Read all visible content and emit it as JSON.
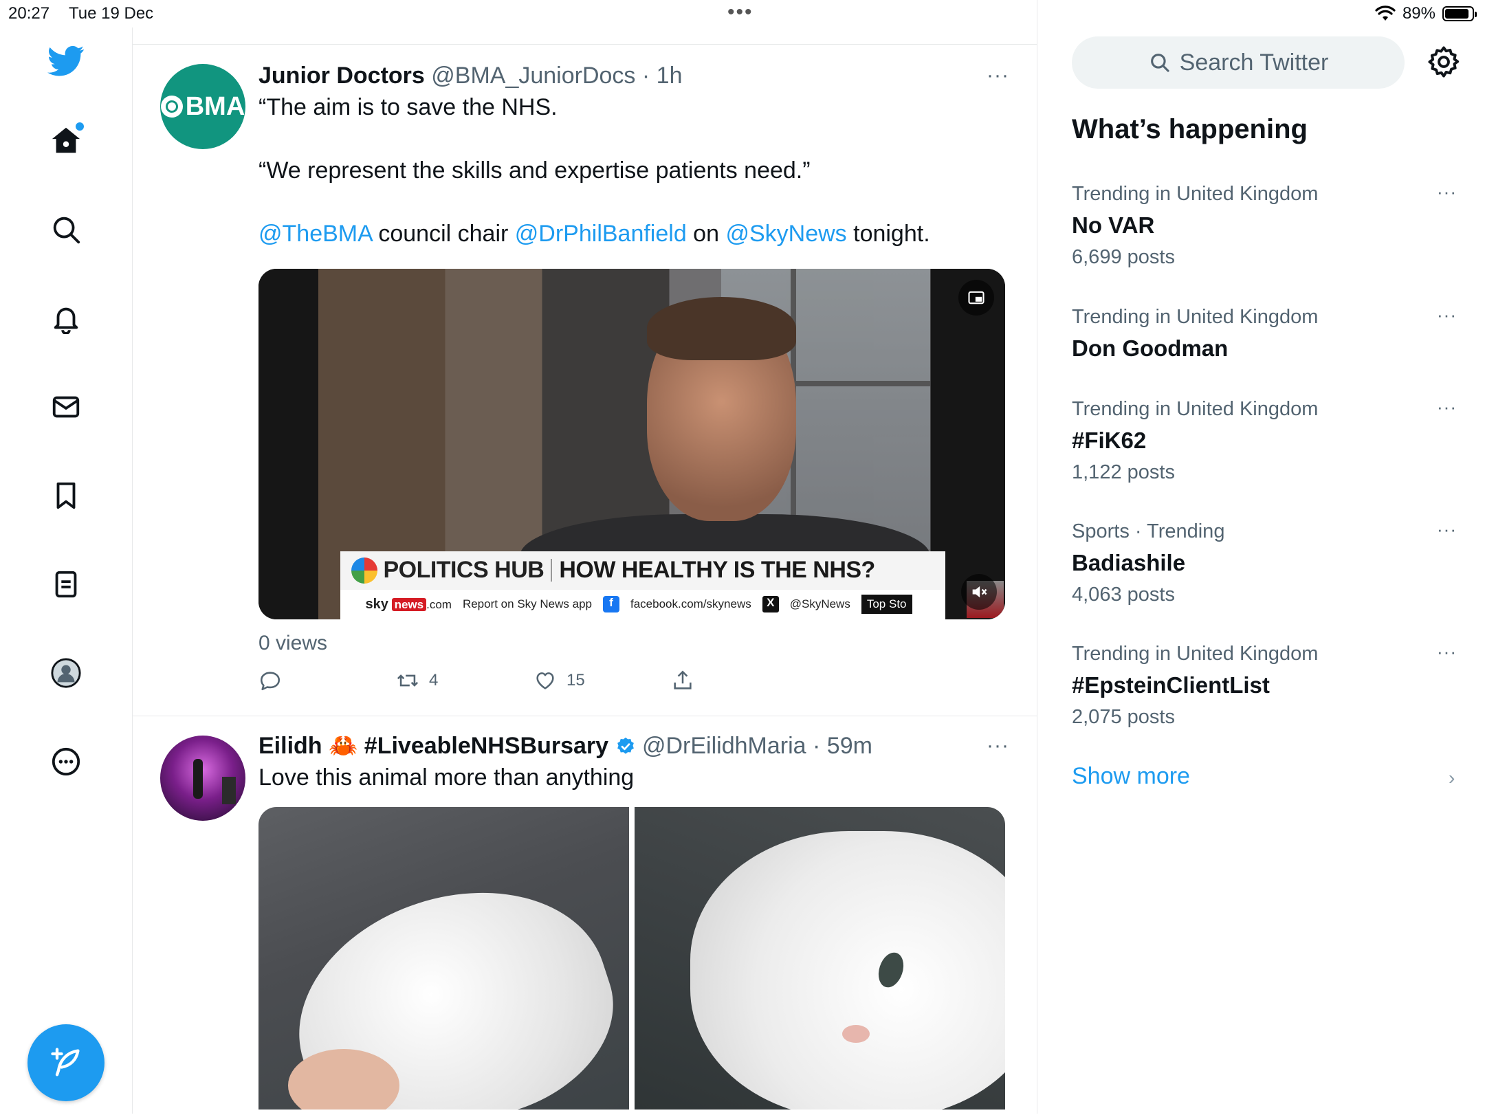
{
  "status_bar": {
    "time": "20:27",
    "date": "Tue 19 Dec",
    "dots": "•••",
    "battery": "89%",
    "battery_level": 0.89
  },
  "nav": {
    "items": [
      "home-icon",
      "explore-icon",
      "notifications-icon",
      "messages-icon",
      "bookmarks-icon",
      "lists-icon",
      "profile-icon",
      "more-icon"
    ],
    "accent": "#1d9bf0"
  },
  "tweets": [
    {
      "name": "Junior Doctors",
      "handle": "@BMA_JuniorDocs",
      "sep": "·",
      "time": "1h",
      "avatar_text": "BMA",
      "more": "···",
      "lines": [
        "“The aim is to save the NHS.",
        "“We represent the skills and expertise patients need.”"
      ],
      "line3": {
        "m1": "@TheBMA",
        "t1": " council chair ",
        "m2": "@DrPhilBanfield",
        "t2": " on ",
        "m3": "@SkyNews",
        "t3": " tonight."
      },
      "video": {
        "lower_third_left": "POLITICS HUB",
        "lower_third_headline": "HOW HEALTHY IS THE NHS?",
        "ticker_sky": "sky",
        "ticker_news": "news",
        "ticker_com": ".com",
        "ticker_app": "Report on Sky News app",
        "ticker_fb_icon": "f",
        "ticker_fb": "facebook.com/skynews",
        "ticker_x_icon": "X",
        "ticker_x": "@SkyNews",
        "ticker_top": "Top Sto"
      },
      "views": "0 views",
      "reply_count": "",
      "retweet_count": "4",
      "like_count": "15"
    },
    {
      "name": "Eilidh 🦀 #LiveableNHSBursary",
      "handle": "@DrEilidhMaria",
      "sep": "·",
      "time": "59m",
      "more": "···",
      "text": "Love this animal more than anything"
    }
  ],
  "sidebar": {
    "search_placeholder": "Search Twitter",
    "heading": "What’s happening",
    "trends": [
      {
        "context": "Trending in United Kingdom",
        "title": "No VAR",
        "count": "6,699 posts"
      },
      {
        "context": "Trending in United Kingdom",
        "title": "Don Goodman",
        "count": ""
      },
      {
        "context": "Trending in United Kingdom",
        "title": "#FiK62",
        "count": "1,122 posts"
      },
      {
        "context": "Sports · Trending",
        "title": "Badiashile",
        "count": "4,063 posts"
      },
      {
        "context": "Trending in United Kingdom",
        "title": "#EpsteinClientList",
        "count": "2,075 posts"
      }
    ],
    "trend_more": "···",
    "show_more": "Show more",
    "chevron": "›"
  }
}
